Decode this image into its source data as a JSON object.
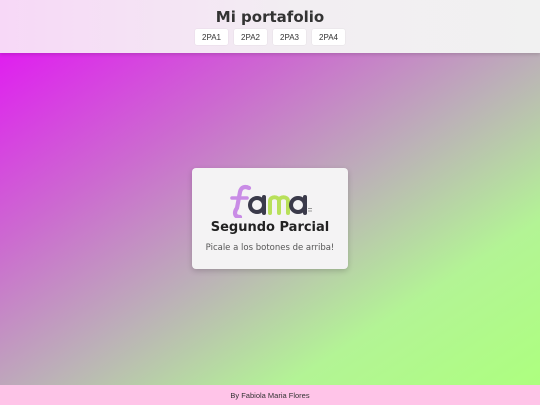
{
  "header": {
    "title": "Mi portafolio",
    "nav": [
      {
        "label": "2PA1"
      },
      {
        "label": "2PA2"
      },
      {
        "label": "2PA3"
      },
      {
        "label": "2PA4"
      }
    ]
  },
  "card": {
    "logo_text": "fama",
    "title": "Segundo Parcial",
    "text": "Picale a los botones de arriba!"
  },
  "footer": {
    "text": "By Fabiola Maria Flores"
  },
  "colors": {
    "gradient_start": "#e01ef0",
    "gradient_end": "#adff7f",
    "footer_bg": "#ffc4e8",
    "logo_f": "#c98ce6",
    "logo_a": "#3a3a4a",
    "logo_m": "#b8e05a"
  }
}
